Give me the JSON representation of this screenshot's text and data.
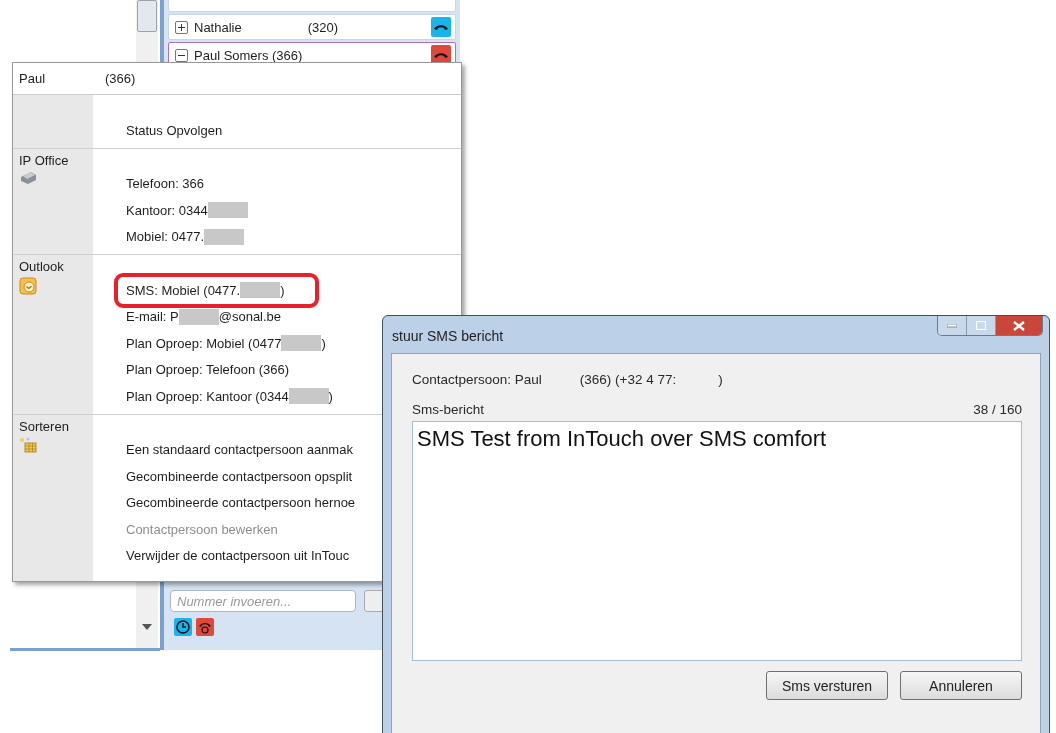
{
  "contact_list": {
    "rows": [
      {
        "name": "Nathalie",
        "ext": "(320)",
        "expanded": false,
        "selected": false,
        "color": "#19b4ea"
      },
      {
        "name": "Paul Somers (366)",
        "ext": "",
        "expanded": true,
        "selected": true,
        "color": "#e0483c"
      }
    ],
    "number_field": {
      "placeholder": "Nummer invoeren..."
    }
  },
  "context_menu": {
    "header": {
      "name": "Paul",
      "ext": "(366)"
    },
    "sections": [
      {
        "kind": "plain",
        "items": [
          {
            "text": "Status Opvolgen",
            "redacted": false,
            "disabled": false,
            "highlighted": false
          }
        ]
      },
      {
        "label": "IP Office",
        "kind": "phone",
        "items": [
          {
            "text": "Telefoon: 366",
            "redacted": false,
            "disabled": false,
            "highlighted": false
          },
          {
            "text": "Kantoor: 0344",
            "redacted": true,
            "disabled": false,
            "highlighted": false
          },
          {
            "text": "Mobiel: 0477.",
            "redacted": true,
            "disabled": false,
            "highlighted": false
          }
        ]
      },
      {
        "label": "Outlook",
        "kind": "calendar",
        "items": [
          {
            "text": "SMS: Mobiel (0477.",
            "redacted": true,
            "after": ")",
            "disabled": false,
            "highlighted": true
          },
          {
            "text": "E-mail: P",
            "redacted": true,
            "after": "@sonal.be",
            "disabled": false,
            "highlighted": false
          },
          {
            "text": "Plan Oproep: Mobiel (0477",
            "redacted": true,
            "after": ")",
            "disabled": false,
            "highlighted": false
          },
          {
            "text": "Plan Oproep: Telefoon (366)",
            "redacted": false,
            "disabled": false,
            "highlighted": false
          },
          {
            "text": "Plan Oproep: Kantoor (0344",
            "redacted": true,
            "after": ")",
            "disabled": false,
            "highlighted": false
          }
        ]
      },
      {
        "label": "Sorteren",
        "kind": "sort",
        "items": [
          {
            "text": "Een standaard contactpersoon aanmak",
            "redacted": false,
            "disabled": false,
            "highlighted": false
          },
          {
            "text": "Gecombineerde contactpersoon opsplit",
            "redacted": false,
            "disabled": false,
            "highlighted": false
          },
          {
            "text": "Gecombineerde contactpersoon hernoe",
            "redacted": false,
            "disabled": false,
            "highlighted": false
          },
          {
            "text": "Contactpersoon bewerken",
            "redacted": false,
            "disabled": true,
            "highlighted": false
          },
          {
            "text": "Verwijder de contactpersoon uit InTouc",
            "redacted": false,
            "disabled": false,
            "highlighted": false
          }
        ]
      }
    ]
  },
  "dialog": {
    "title": "stuur SMS bericht",
    "contact_label": "Contactpersoon: Paul",
    "contact_number": "(366) (+32 4 77:",
    "contact_end": ")",
    "message_label": "Sms-bericht",
    "counter": "38 / 160",
    "message": "SMS Test from InTouch over SMS comfort",
    "buttons": [
      "Sms versturen",
      "Annuleren"
    ]
  }
}
